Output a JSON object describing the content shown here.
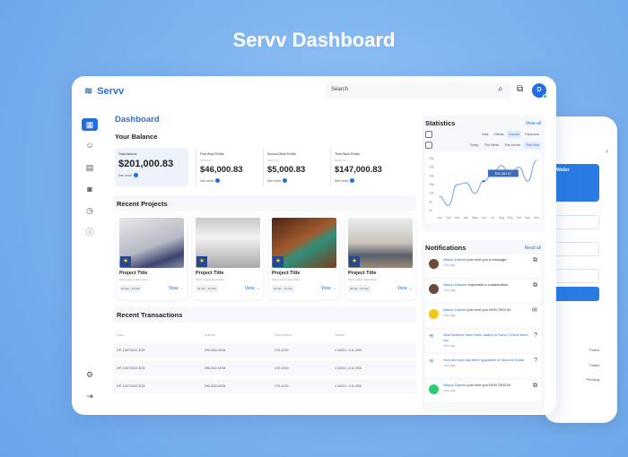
{
  "hero_title": "Servv Dashboard",
  "app": {
    "name": "Servv",
    "search_placeholder": "Search",
    "avatar_initial": "D"
  },
  "page_title": "Dashboard",
  "balance": {
    "title": "Your Balance",
    "cards": [
      {
        "label": "Total balance",
        "sub": "",
        "value": "$201,000.83",
        "more": "See more"
      },
      {
        "label": "First Work Profile",
        "sub": "Balance",
        "value": "$46,000.83",
        "more": "See more"
      },
      {
        "label": "Second Work Profile",
        "sub": "Balance",
        "value": "$5,000.83",
        "more": "See more"
      },
      {
        "label": "Third Work Profile",
        "sub": "Balance",
        "value": "$147,000.83",
        "more": "See more"
      }
    ]
  },
  "projects": {
    "title": "Recent Projects",
    "items": [
      {
        "title": "Project Title",
        "desc": "Short project description",
        "date": "28 Jan - 10 Feb",
        "view": "View →"
      },
      {
        "title": "Project Title",
        "desc": "Short project description",
        "date": "28 Jan - 10 Feb",
        "view": "View →"
      },
      {
        "title": "Project Title",
        "desc": "Short project description",
        "date": "28 Jan - 10 Feb",
        "view": "View →"
      },
      {
        "title": "Project Title",
        "desc": "Short project description",
        "date": "28 Jan - 10 Feb",
        "view": "View →"
      }
    ]
  },
  "transactions": {
    "title": "Recent Transactions",
    "columns": [
      "Date",
      "Activity",
      "Description",
      "Status"
    ],
    "rows": [
      [
        "DP-13072022-E25",
        "290,000-NGN",
        "170-USD",
        "1 NGN = 0.6 USD"
      ],
      [
        "DP-13072022-E25",
        "290,000-NGN",
        "170-USD",
        "1 NGN = 0.6 USD"
      ],
      [
        "DP-13072022-E25",
        "290,000-NGN",
        "170-USD",
        "1 NGN = 0.6 USD"
      ]
    ]
  },
  "statistics": {
    "title": "Statistics",
    "view_all": "View all",
    "filters": [
      "Jobs",
      "Clients",
      "Income",
      "Expenses"
    ],
    "active_filter": "Income",
    "periods": [
      "Today",
      "This Week",
      "This Month",
      "This Year"
    ],
    "active_period": "This Year",
    "tooltip": "$22,364.97",
    "chart": {
      "months": [
        "Jan",
        "Feb",
        "Mar",
        "Apr",
        "May",
        "Jun",
        "Jul",
        "Aug",
        "Sep",
        "Oct",
        "Nov",
        "Dec"
      ],
      "yticks": [
        "0k",
        "5k",
        "10k",
        "15k",
        "20k",
        "25k",
        "30k"
      ],
      "values": [
        8,
        3,
        15,
        16,
        10,
        17,
        21,
        26,
        21,
        25,
        17,
        29
      ],
      "ymax": 30
    }
  },
  "notifications": {
    "title": "Notifications",
    "read_all": "Read all",
    "items": [
      {
        "name": "Allison Daniels",
        "text": " just sent you a message.",
        "time": "10m ago",
        "avatar": "#6b4a3a",
        "icon": "⧉"
      },
      {
        "name": "Allison Daniels",
        "text": " requested a collaboration",
        "time": "10m ago",
        "avatar": "#6b4a3a",
        "icon": "⧉"
      },
      {
        "name": "Allison Daniels",
        "text": " just sent you NGN 7500.00",
        "time": "10m ago",
        "avatar": "#f5c518",
        "icon": "✉"
      },
      {
        "name": "",
        "text": "New features have been added to Servv. Check them out.",
        "time": "10m ago",
        "avatar": "",
        "icon": "?"
      },
      {
        "name": "",
        "text": "Your account has been upgraded to Second Grade",
        "time": "10m ago",
        "avatar": "",
        "icon": "?"
      },
      {
        "name": "Allison Daniels",
        "text": " just sent you NGN 7500.00",
        "time": "10m ago",
        "avatar": "#2ecc71",
        "icon": "⧉"
      }
    ]
  },
  "phone": {
    "wallet": "Wallet",
    "statuses": [
      "Failed",
      "Failed",
      "Pending"
    ]
  }
}
